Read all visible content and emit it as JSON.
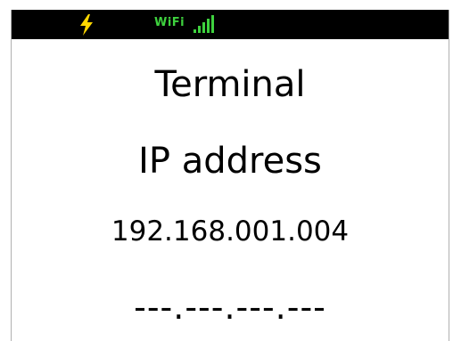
{
  "status_bar": {
    "power_icon": "lightning-bolt-icon",
    "wifi_label": "WiFi",
    "signal_icon": "signal-bars-icon",
    "colors": {
      "background": "#000000",
      "power": "#ffd700",
      "wifi": "#3ed13e"
    }
  },
  "screen": {
    "title": "Terminal",
    "subtitle": "IP address",
    "current_ip": "192.168.001.004",
    "ip_entry": "---.---.---.---"
  }
}
